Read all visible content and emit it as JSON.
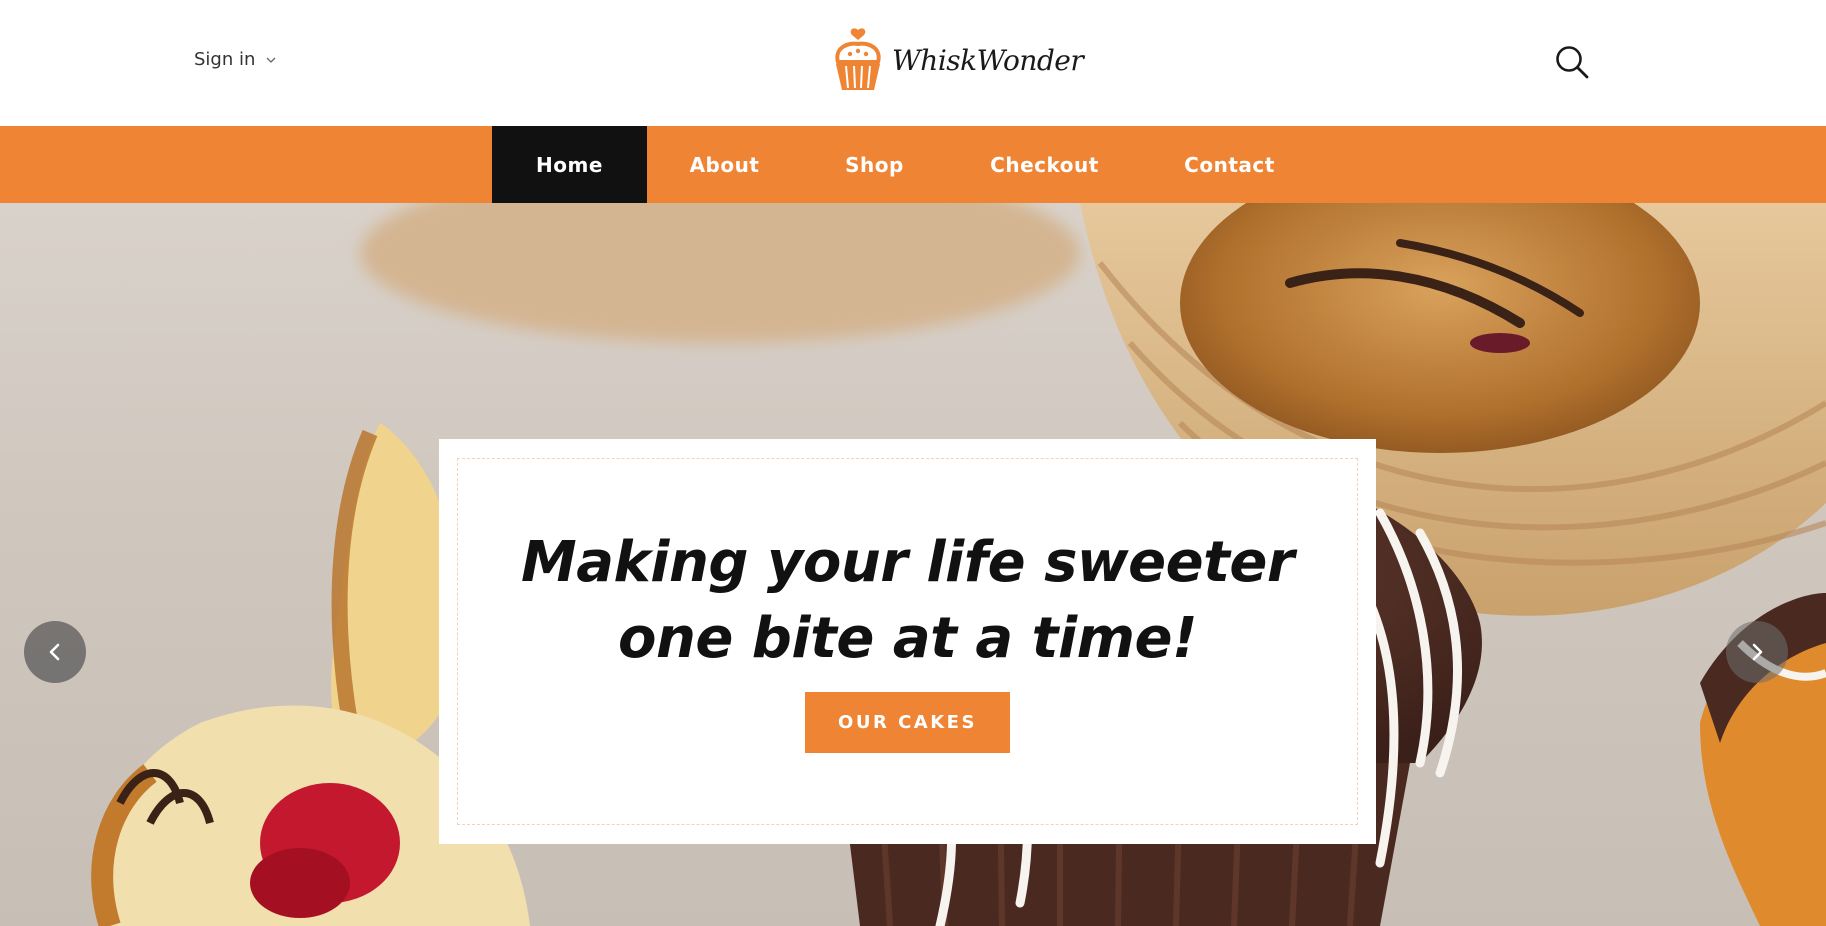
{
  "header": {
    "signin_label": "Sign in",
    "brand_name": "WhiskWonder",
    "icons": {
      "signin_chevron": "chevron-down-icon",
      "logo": "cupcake-icon",
      "search": "search-icon"
    }
  },
  "nav": {
    "items": [
      {
        "label": "Home",
        "active": true
      },
      {
        "label": "About"
      },
      {
        "label": "Shop"
      },
      {
        "label": "Checkout"
      },
      {
        "label": "Contact"
      }
    ]
  },
  "hero": {
    "headline_line1": "Making your life sweeter",
    "headline_line2": "one bite at a time!",
    "cta_label": "OUR CAKES",
    "prev_icon": "chevron-left-icon",
    "next_icon": "chevron-right-icon"
  },
  "colors": {
    "accent": "#ef8534",
    "nav_active_bg": "#111111",
    "text_dark": "#111111"
  }
}
